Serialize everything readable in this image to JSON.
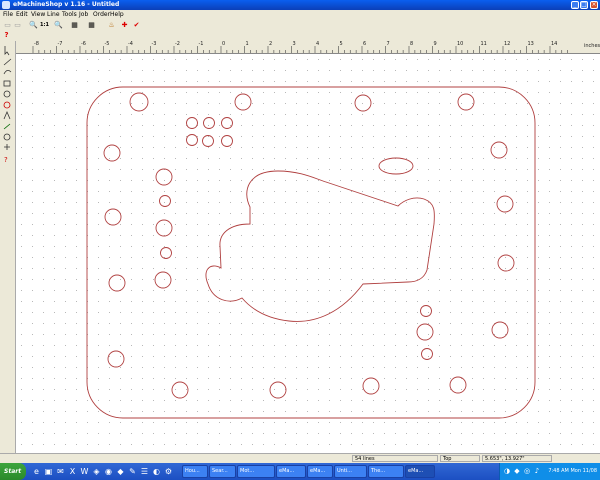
{
  "window": {
    "title": "eMachineShop v 1.16 - Untitled",
    "min": "_",
    "max": "□",
    "close": "×"
  },
  "menu": [
    "File",
    "Edit",
    "View",
    "Line",
    "Tools",
    "Job",
    "Order",
    "Help"
  ],
  "toolbar": {
    "icons": [
      "new-icon",
      "open-icon",
      "zoom-fit-icon",
      "zoom-actual-icon",
      "zoom-in-icon",
      "view-2d-icon",
      "view-3d-icon",
      "material-icon",
      "price-icon",
      "order-icon"
    ],
    "glyphs": [
      "▭",
      "▭",
      "🔍",
      "1:1",
      "🔍",
      "▦",
      "▦",
      "♨",
      "✚",
      "✔"
    ]
  },
  "ruler": {
    "top_labels": [
      "-8",
      "-7",
      "-6",
      "-5",
      "-4",
      "-3",
      "-2",
      "-1",
      "0",
      "1",
      "2",
      "3",
      "4",
      "5",
      "6",
      "7",
      "8",
      "9",
      "10",
      "11",
      "12",
      "13",
      "14"
    ],
    "unit": "inches"
  },
  "status": {
    "lines": "54 lines",
    "layer": "Top",
    "coords": "5.653\", 13.927\""
  },
  "taskbar": {
    "start": "Start",
    "tasks": [
      "Hou...",
      "Sear...",
      "Mot...",
      "eMa...",
      "eMa...",
      "Unti...",
      "The...",
      "eMa..."
    ],
    "clock": "7:48 AM Mon 11/08"
  }
}
